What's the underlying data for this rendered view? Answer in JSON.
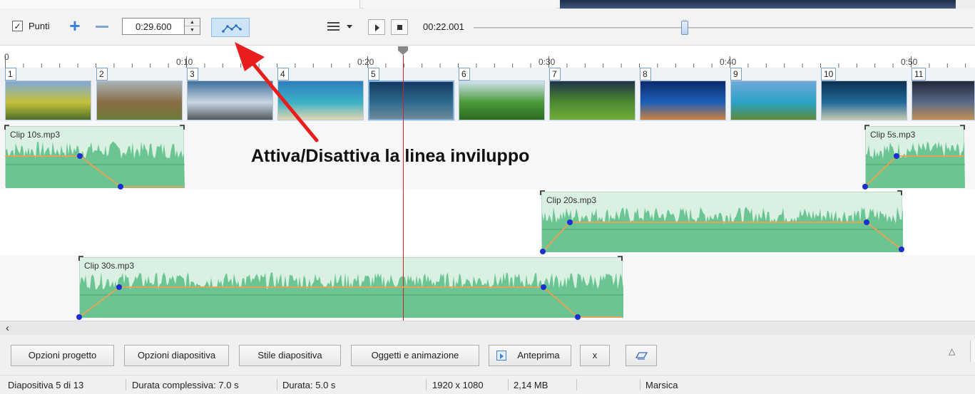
{
  "toolbar": {
    "points_label": "Punti",
    "points_checked": true,
    "duration_value": "0:29.600",
    "position_label": "00:22.001",
    "position_fraction": 0.42,
    "icons": [
      "add-point-icon",
      "remove-point-icon",
      "envelope-line-icon",
      "menu-icon",
      "play-icon",
      "stop-icon"
    ]
  },
  "ruler": {
    "labels": [
      "0",
      "0:10",
      "0:20",
      "0:30",
      "0:40",
      "0:50"
    ]
  },
  "slides": [
    {
      "num": "1",
      "colors": [
        "#7fa8d8",
        "#c6c13a",
        "#4d6e2a"
      ]
    },
    {
      "num": "2",
      "colors": [
        "#a9b3b8",
        "#8a6d45",
        "#6c7c3a"
      ]
    },
    {
      "num": "3",
      "colors": [
        "#3f6f9a",
        "#c7d6e2",
        "#555a5e"
      ]
    },
    {
      "num": "4",
      "colors": [
        "#2f7fbf",
        "#3bb0c4",
        "#e3d7b0"
      ]
    },
    {
      "num": "5",
      "colors": [
        "#143a60",
        "#2d6a8c",
        "#6e8a99"
      ]
    },
    {
      "num": "6",
      "colors": [
        "#cfe2ee",
        "#4a9a3a",
        "#2d6a20"
      ]
    },
    {
      "num": "7",
      "colors": [
        "#1f3447",
        "#4d8a30",
        "#6fae3a"
      ]
    },
    {
      "num": "8",
      "colors": [
        "#0c2a6a",
        "#1b5fb8",
        "#d08040"
      ]
    },
    {
      "num": "9",
      "colors": [
        "#70a8d8",
        "#2aa2c8",
        "#5c8a3a"
      ]
    },
    {
      "num": "10",
      "colors": [
        "#0b3050",
        "#236a9a",
        "#c6c8b0"
      ]
    },
    {
      "num": "11",
      "colors": [
        "#20283a",
        "#5a6a8a",
        "#c09050"
      ]
    }
  ],
  "clips": [
    {
      "name": "Clip 10s.mp3"
    },
    {
      "name": "Clip 5s.mp3"
    },
    {
      "name": "Clip 20s.mp3"
    },
    {
      "name": "Clip 30s.mp3"
    }
  ],
  "annotation": "Attiva/Disattiva la linea inviluppo",
  "buttons": {
    "project_options": "Opzioni progetto",
    "slide_options": "Opzioni diapositiva",
    "slide_style": "Stile diapositiva",
    "objects_animation": "Oggetti e animazione",
    "preview": "Anteprima",
    "close": "x"
  },
  "status": {
    "slide": "Diapositiva 5 di 13",
    "total_duration": "Durata complessiva: 7.0 s",
    "duration": "Durata: 5.0 s",
    "resolution": "1920 x 1080",
    "size": "2,14 MB",
    "name": "Marsica"
  },
  "colors": {
    "playhead": "#d0202a",
    "envelope": "#f0a050",
    "waveform": "#5ec08a",
    "point": "#1a2fd0",
    "annotation_arrow": "#e81e1e"
  }
}
